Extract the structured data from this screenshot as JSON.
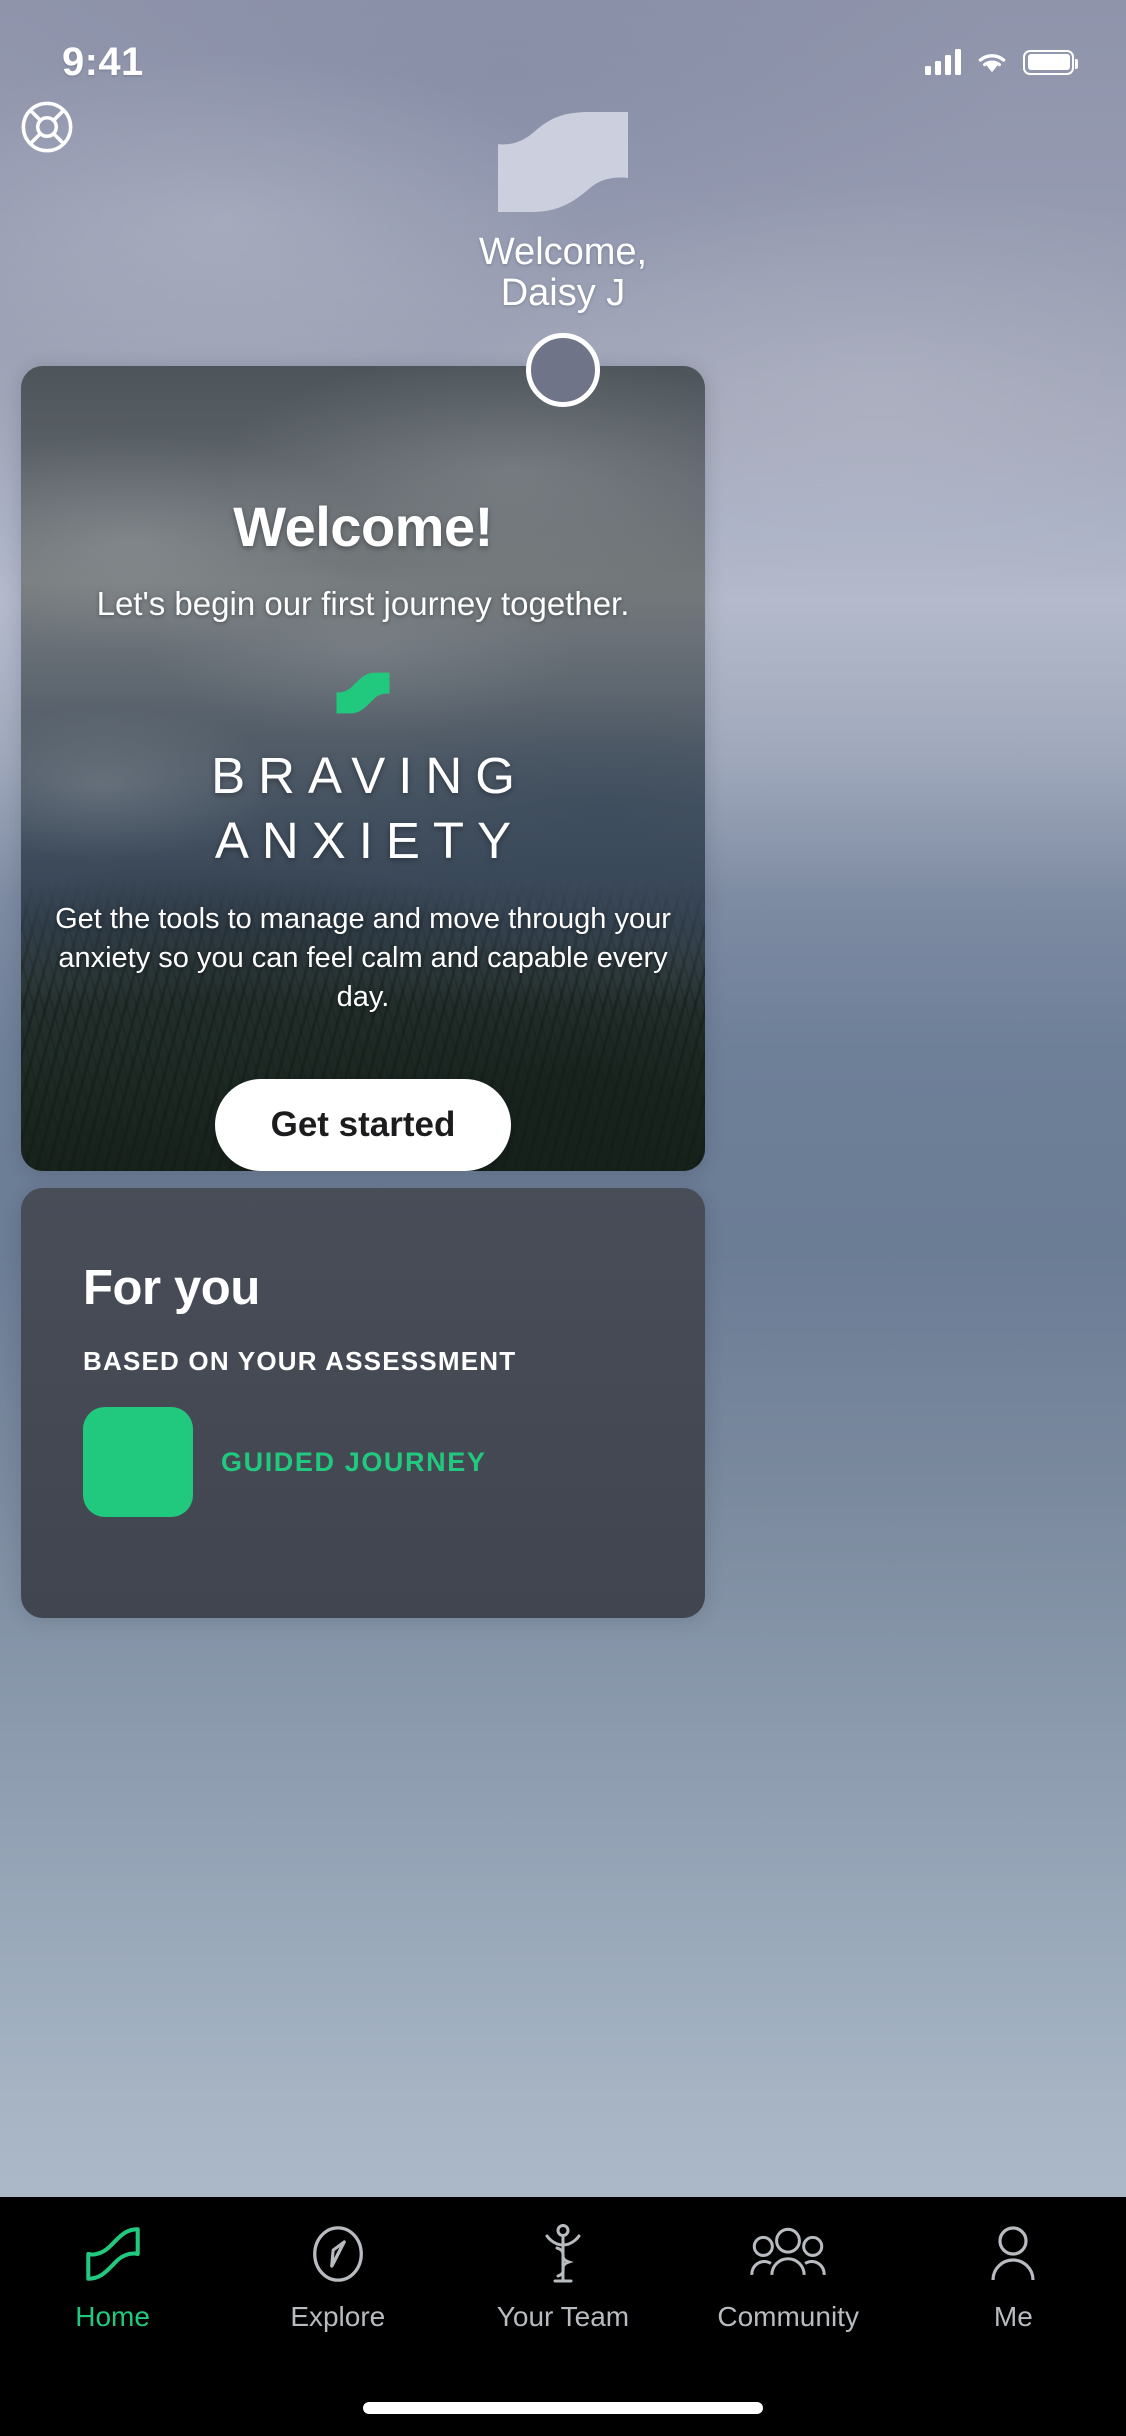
{
  "status_bar": {
    "time": "9:41",
    "cellular_icon": "signal-bars-icon",
    "wifi_icon": "wifi-icon",
    "battery_icon": "battery-full-icon"
  },
  "header": {
    "help_icon": "life-ring-help-icon",
    "brand_logo_icon": "braving-s-wave-logo-icon",
    "welcome_line_1": "Welcome,",
    "welcome_line_2": "Daisy J",
    "avatar_icon": "user-avatar"
  },
  "hero_card": {
    "title": "Welcome!",
    "subtitle": "Let's begin our first journey together.",
    "logo_icon": "braving-s-wave-logo-green-icon",
    "program_line_1": "BRAVING",
    "program_line_2": "ANXIETY",
    "description": "Get the tools to manage and move through your anxiety so you can feel calm and capable every day.",
    "cta_label": "Get started"
  },
  "for_you": {
    "title": "For you",
    "subtitle": "BASED ON YOUR ASSESSMENT",
    "item_tag": "GUIDED JOURNEY"
  },
  "tab_bar": {
    "items": [
      {
        "label": "Home",
        "icon": "s-wave-home-icon",
        "active": true
      },
      {
        "label": "Explore",
        "icon": "compass-icon",
        "active": false
      },
      {
        "label": "Your Team",
        "icon": "caduceus-icon",
        "active": false
      },
      {
        "label": "Community",
        "icon": "people-group-icon",
        "active": false
      },
      {
        "label": "Me",
        "icon": "person-icon",
        "active": false
      }
    ]
  },
  "colors": {
    "accent_green": "#21c97e",
    "tab_bar_background": "#000000",
    "card_background": "#484d58",
    "cta_background": "#ffffff",
    "text_primary": "#ffffff",
    "text_muted": "#b8bcc0"
  }
}
